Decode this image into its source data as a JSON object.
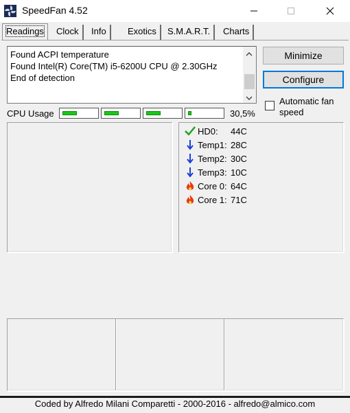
{
  "window": {
    "title": "SpeedFan 4.52",
    "icon": "fan-icon",
    "minimize_icon": "minimize-icon",
    "maximize_icon": "maximize-icon",
    "close_icon": "close-icon"
  },
  "tabs": [
    {
      "label": "Readings",
      "active": true
    },
    {
      "label": "Clock"
    },
    {
      "label": "Info"
    },
    {
      "label": "Exotics"
    },
    {
      "label": "S.M.A.R.T."
    },
    {
      "label": "Charts"
    }
  ],
  "log": {
    "lines": [
      "Found ACPI temperature",
      "Found Intel(R) Core(TM) i5-6200U CPU @ 2.30GHz",
      "End of detection"
    ]
  },
  "buttons": {
    "minimize": "Minimize",
    "configure": "Configure"
  },
  "auto_fan": {
    "label": "Automatic fan speed",
    "checked": false
  },
  "cpu": {
    "label": "CPU Usage",
    "value": "30,5%",
    "core_levels": [
      0.45,
      0.45,
      0.45,
      0.1
    ]
  },
  "readings": [
    {
      "label": "HD0:",
      "value": "44C",
      "icon": "check-icon"
    },
    {
      "label": "Temp1:",
      "value": "28C",
      "icon": "arrow-down-icon"
    },
    {
      "label": "Temp2:",
      "value": "30C",
      "icon": "arrow-down-icon"
    },
    {
      "label": "Temp3:",
      "value": "10C",
      "icon": "arrow-down-icon"
    },
    {
      "label": "Core 0:",
      "value": "64C",
      "icon": "flame-icon"
    },
    {
      "label": "Core 1:",
      "value": "71C",
      "icon": "flame-icon"
    }
  ],
  "status": {
    "text": "Coded by Alfredo Milani Comparetti - 2000-2016 - alfredo@almico.com"
  },
  "colors": {
    "meter_fill": "#19c819",
    "check": "#1f9e1f",
    "arrow": "#1a3fd6",
    "flame": "#e53a12",
    "accent": "#0078d7"
  }
}
